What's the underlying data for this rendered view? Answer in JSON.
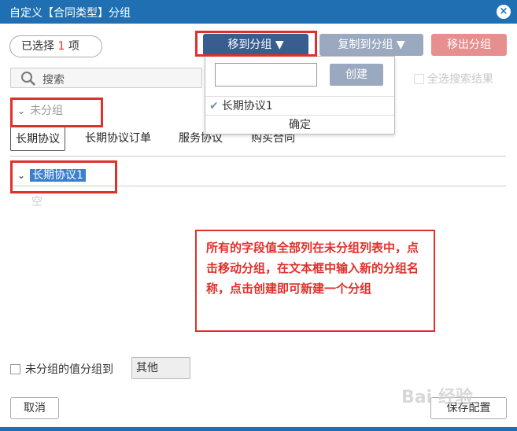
{
  "dialog": {
    "title": "自定义【合同类型】分组",
    "close_symbol": "×"
  },
  "selection": {
    "prefix": "已选择",
    "count": "1",
    "suffix": "项"
  },
  "toolbar": {
    "move_label": "移到分组 ▼",
    "copy_label": "复制到分组 ▼",
    "remove_label": "移出分组"
  },
  "search": {
    "placeholder": "搜索",
    "select_all_label": "全选搜索结果"
  },
  "ungrouped": {
    "label": "未分组",
    "tags": [
      "长期协议",
      "长期协议订单",
      "服务协议",
      "购买合同"
    ]
  },
  "group": {
    "name": "长期协议1",
    "empty_label": "空"
  },
  "dropdown": {
    "input_value": "",
    "create_label": "创建",
    "item_label": "长期协议1",
    "confirm_label": "确定"
  },
  "annotation": {
    "text": "所有的字段值全部列在未分组列表中，点击移动分组，在文本框中输入新的分组名称，点击创建即可新建一个分组"
  },
  "footer": {
    "ungrouped_to_label": "未分组的值分组到",
    "other_value": "其他",
    "cancel_label": "取消",
    "save_label": "保存配置"
  },
  "watermark": {
    "text": "Bai 经验"
  },
  "colors": {
    "titlebar": "#1f6fb2",
    "primary_button": "#3a5d8f",
    "disabled_button": "#9aa9bf",
    "danger_button": "#e78e8e",
    "highlight": "#e0302a",
    "selection": "#3d7fce"
  }
}
